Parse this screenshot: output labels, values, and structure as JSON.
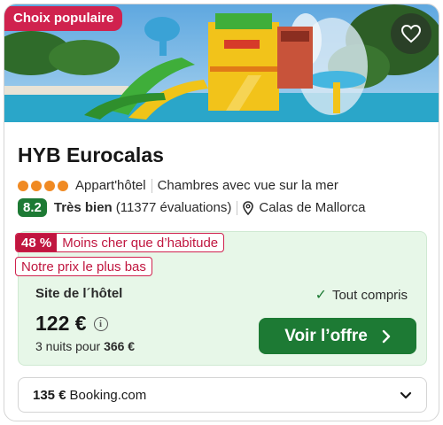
{
  "badge": "Choix populaire",
  "hotel": {
    "name": "HYB Eurocalas",
    "stars": 4,
    "type": "Appart'hôtel",
    "feature": "Chambres avec vue sur la mer",
    "score": "8.2",
    "score_label": "Très bien",
    "reviews": "(11377 évaluations)",
    "location": "Calas de Mallorca"
  },
  "deal": {
    "discount": "48 %",
    "discount_text": "Moins cher que d’habitude",
    "lowest_price": "Notre prix le plus bas",
    "provider": "Site de l´hôtel",
    "all_inclusive": "Tout compris",
    "price": "122 €",
    "nights_text": "3 nuits pour",
    "total": "366 €",
    "cta": "Voir l’offre"
  },
  "other_offer": {
    "price": "135 €",
    "provider": "Booking.com"
  },
  "colors": {
    "badge": "#d0224e",
    "score": "#1d7a34",
    "stars": "#f08a23",
    "deal_bg": "#e7f7e8",
    "cta": "#1d7a34",
    "discount": "#c0163f"
  },
  "icons": [
    "heart-icon",
    "info-icon",
    "location-pin-icon",
    "check-icon",
    "chevron-right-icon",
    "chevron-down-icon"
  ]
}
